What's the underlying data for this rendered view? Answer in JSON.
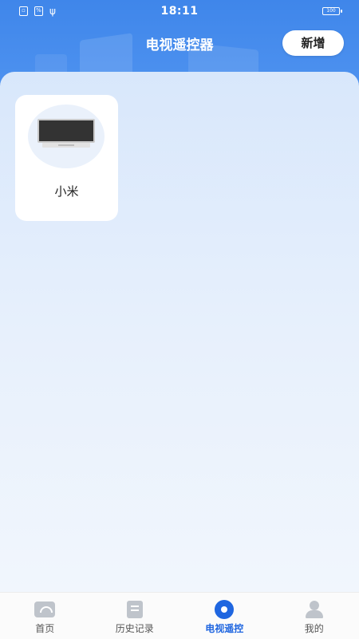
{
  "status_bar": {
    "time": "18:11",
    "battery": "100",
    "left_icons": [
      "sim-icon",
      "data-icon",
      "usb-icon"
    ]
  },
  "header": {
    "title": "电视遥控器",
    "add_button": "新增"
  },
  "devices": [
    {
      "name": "小米",
      "icon": "tv-icon"
    }
  ],
  "tabbar": {
    "tabs": [
      {
        "label": "首页",
        "icon": "home-wifi-icon",
        "active": false
      },
      {
        "label": "历史记录",
        "icon": "clipboard-icon",
        "active": false
      },
      {
        "label": "电视遥控",
        "icon": "remote-icon",
        "active": true
      },
      {
        "label": "我的",
        "icon": "person-icon",
        "active": false
      }
    ]
  },
  "colors": {
    "header_blue": "#3f86ea",
    "active_tab": "#1f66e0"
  }
}
